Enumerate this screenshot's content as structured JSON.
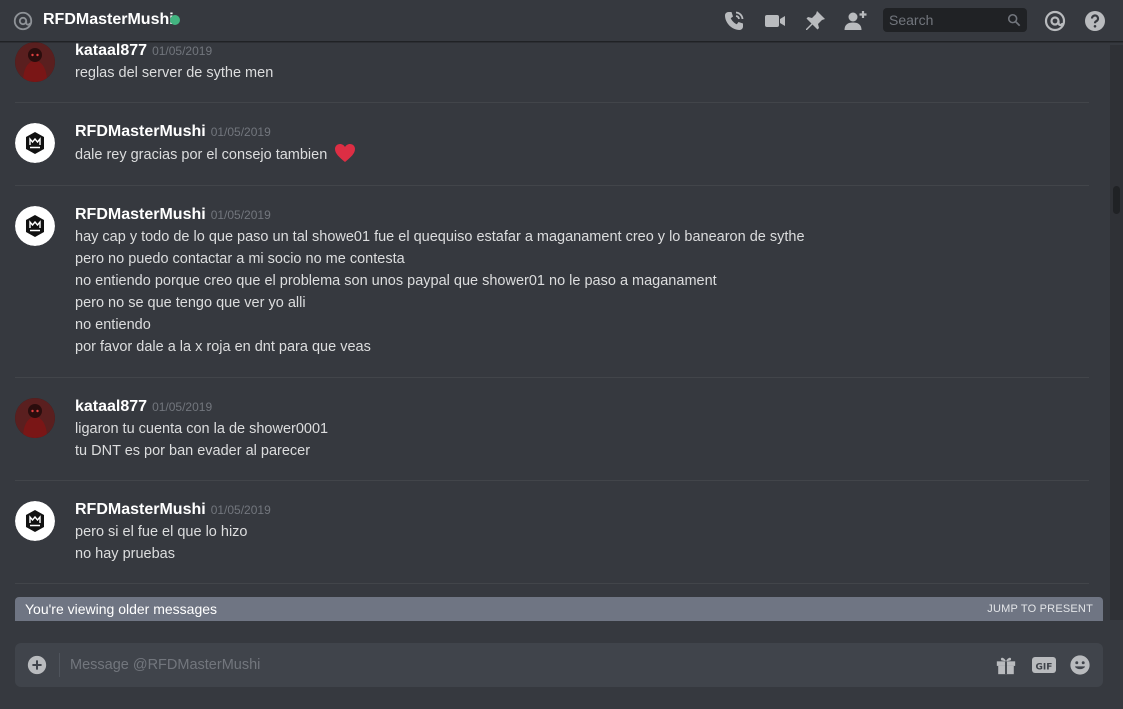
{
  "header": {
    "title": "RFDMasterMushi",
    "icons": [
      "at-icon",
      "phone-call-icon",
      "video-call-icon",
      "pin-icon",
      "add-friend-icon",
      "search-icon",
      "mentions-icon",
      "help-icon"
    ],
    "status_color": "#43b581",
    "search_placeholder": "Search"
  },
  "messages": [
    {
      "author": "kataal877",
      "timestamp": "01/05/2019",
      "avatar": "kataal-avatar",
      "lines": [
        "reglas del server de sythe men"
      ]
    },
    {
      "author": "RFDMasterMushi",
      "timestamp": "01/05/2019",
      "avatar": "rfd-avatar",
      "lines": [
        "dale rey gracias por el consejo tambien"
      ],
      "emoji": "heart-emoji"
    },
    {
      "author": "RFDMasterMushi",
      "timestamp": "01/05/2019",
      "avatar": "rfd-avatar",
      "lines": [
        "hay cap y todo de lo que paso un tal showe01 fue el quequiso estafar a maganament creo y lo banearon de sythe",
        "pero no puedo contactar a mi socio no me contesta",
        "no entiendo porque creo que el problema son unos paypal que shower01 no le paso a maganament",
        "pero no se que tengo que ver yo alli",
        "no entiendo",
        "por favor dale a la x roja en dnt para que veas"
      ]
    },
    {
      "author": "kataal877",
      "timestamp": "01/05/2019",
      "avatar": "kataal-avatar",
      "lines": [
        "ligaron tu cuenta con la de shower0001",
        "tu DNT es por ban evader al parecer"
      ]
    },
    {
      "author": "RFDMasterMushi",
      "timestamp": "01/05/2019",
      "avatar": "rfd-avatar",
      "lines": [
        "pero si el fue el que lo hizo",
        "no hay pruebas"
      ]
    }
  ],
  "older_bar": {
    "text": "You're viewing older messages",
    "jump_label": "JUMP TO PRESENT"
  },
  "composer": {
    "placeholder": "Message @RFDMasterMushi",
    "icons": [
      "add-attachment-icon",
      "gift-icon",
      "gif-icon",
      "emoji-icon"
    ]
  },
  "colors": {
    "background": "#36393f",
    "accent_heart": "#dd2e44",
    "older_bar": "#6f7583"
  }
}
